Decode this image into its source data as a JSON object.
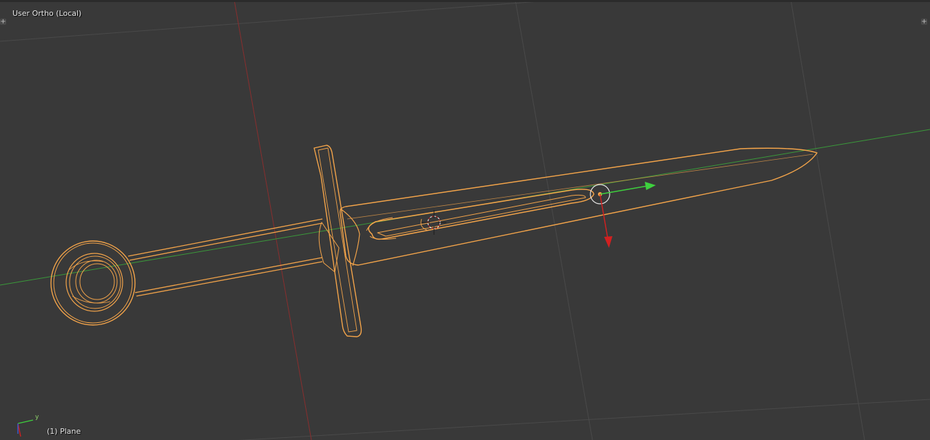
{
  "viewport": {
    "view_label": "User Ortho (Local)",
    "object_label": "(1) Plane",
    "corner_left_symbol": "+",
    "corner_right_symbol": "+",
    "mini_axis_y": "y"
  },
  "colors": {
    "background": "#393939",
    "grid_line": "#4a4a4a",
    "x_axis": "#8a2e2e",
    "y_axis": "#3a9a3a",
    "selection": "#f5a54a",
    "manipulator_y": "#3ed13e",
    "manipulator_z": "#d22020",
    "cursor": "#1a1a1a"
  },
  "icons": [
    "plus-icon",
    "axis-gizmo-icon",
    "3d-cursor-icon",
    "manipulator-icon"
  ]
}
